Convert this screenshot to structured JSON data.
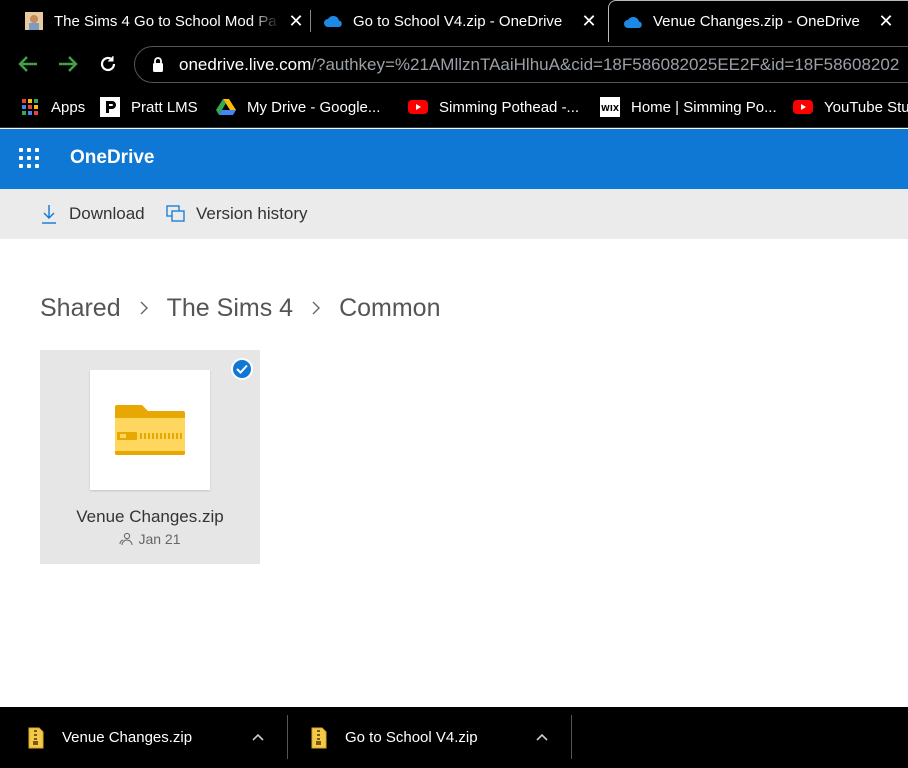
{
  "browser": {
    "tabs": [
      {
        "title": "The Sims 4 Go to School Mod Pa",
        "icon": "sims-favicon-icon",
        "active": false
      },
      {
        "title": "Go to School V4.zip - OneDrive",
        "icon": "onedrive-cloud-icon",
        "active": false
      },
      {
        "title": "Venue Changes.zip - OneDrive",
        "icon": "onedrive-cloud-icon",
        "active": true
      }
    ],
    "close_glyph": "✕",
    "url_host": "onedrive.live.com",
    "url_rest": "/?authkey=%21AMllznTAaiHlhuA&cid=18F586082025EE2F&id=18F58608202",
    "bookmarks": [
      {
        "label": "Apps",
        "icon": "apps-grid-icon"
      },
      {
        "label": "Pratt LMS",
        "icon": "pratt-logo-icon"
      },
      {
        "label": "My Drive - Google...",
        "icon": "google-drive-icon"
      },
      {
        "label": "Simming Pothead -...",
        "icon": "youtube-icon"
      },
      {
        "label": "Home | Simming Po...",
        "icon": "wix-icon"
      },
      {
        "label": "YouTube Studio",
        "icon": "youtube-icon"
      }
    ],
    "colors": {
      "chrome_bg": "#000000",
      "nav_green": "#43a047"
    }
  },
  "onedrive": {
    "brand": "OneDrive",
    "header_color": "#0f78d4",
    "commands": {
      "download": "Download",
      "version_history": "Version history"
    },
    "breadcrumb": [
      "Shared",
      "The Sims 4",
      "Common"
    ],
    "file": {
      "name": "Venue Changes.zip",
      "date": "Jan 21",
      "selected": true,
      "type_icon": "zip-folder-icon"
    }
  },
  "downloads": [
    {
      "name": "Venue Changes.zip",
      "icon": "zip-file-icon"
    },
    {
      "name": "Go to School V4.zip",
      "icon": "zip-file-icon"
    }
  ]
}
